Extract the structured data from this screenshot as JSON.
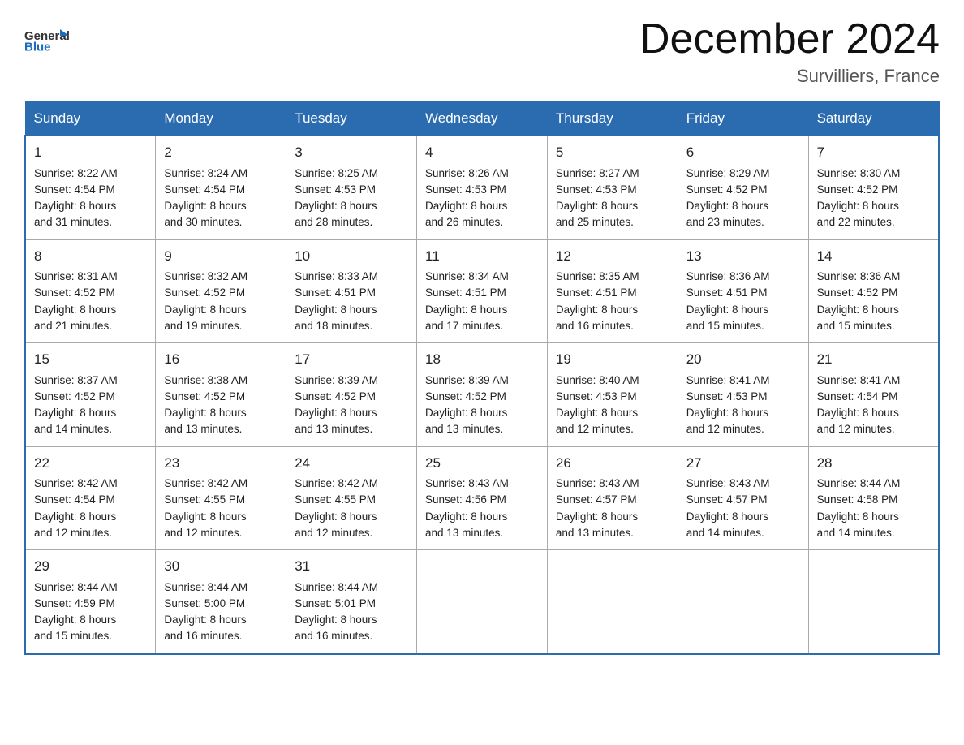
{
  "logo": {
    "general": "General",
    "blue": "Blue",
    "arrow_symbol": "▶"
  },
  "header": {
    "title": "December 2024",
    "subtitle": "Survilliers, France"
  },
  "days_of_week": [
    "Sunday",
    "Monday",
    "Tuesday",
    "Wednesday",
    "Thursday",
    "Friday",
    "Saturday"
  ],
  "weeks": [
    [
      {
        "day": "1",
        "sunrise": "8:22 AM",
        "sunset": "4:54 PM",
        "daylight": "8 hours and 31 minutes."
      },
      {
        "day": "2",
        "sunrise": "8:24 AM",
        "sunset": "4:54 PM",
        "daylight": "8 hours and 30 minutes."
      },
      {
        "day": "3",
        "sunrise": "8:25 AM",
        "sunset": "4:53 PM",
        "daylight": "8 hours and 28 minutes."
      },
      {
        "day": "4",
        "sunrise": "8:26 AM",
        "sunset": "4:53 PM",
        "daylight": "8 hours and 26 minutes."
      },
      {
        "day": "5",
        "sunrise": "8:27 AM",
        "sunset": "4:53 PM",
        "daylight": "8 hours and 25 minutes."
      },
      {
        "day": "6",
        "sunrise": "8:29 AM",
        "sunset": "4:52 PM",
        "daylight": "8 hours and 23 minutes."
      },
      {
        "day": "7",
        "sunrise": "8:30 AM",
        "sunset": "4:52 PM",
        "daylight": "8 hours and 22 minutes."
      }
    ],
    [
      {
        "day": "8",
        "sunrise": "8:31 AM",
        "sunset": "4:52 PM",
        "daylight": "8 hours and 21 minutes."
      },
      {
        "day": "9",
        "sunrise": "8:32 AM",
        "sunset": "4:52 PM",
        "daylight": "8 hours and 19 minutes."
      },
      {
        "day": "10",
        "sunrise": "8:33 AM",
        "sunset": "4:51 PM",
        "daylight": "8 hours and 18 minutes."
      },
      {
        "day": "11",
        "sunrise": "8:34 AM",
        "sunset": "4:51 PM",
        "daylight": "8 hours and 17 minutes."
      },
      {
        "day": "12",
        "sunrise": "8:35 AM",
        "sunset": "4:51 PM",
        "daylight": "8 hours and 16 minutes."
      },
      {
        "day": "13",
        "sunrise": "8:36 AM",
        "sunset": "4:51 PM",
        "daylight": "8 hours and 15 minutes."
      },
      {
        "day": "14",
        "sunrise": "8:36 AM",
        "sunset": "4:52 PM",
        "daylight": "8 hours and 15 minutes."
      }
    ],
    [
      {
        "day": "15",
        "sunrise": "8:37 AM",
        "sunset": "4:52 PM",
        "daylight": "8 hours and 14 minutes."
      },
      {
        "day": "16",
        "sunrise": "8:38 AM",
        "sunset": "4:52 PM",
        "daylight": "8 hours and 13 minutes."
      },
      {
        "day": "17",
        "sunrise": "8:39 AM",
        "sunset": "4:52 PM",
        "daylight": "8 hours and 13 minutes."
      },
      {
        "day": "18",
        "sunrise": "8:39 AM",
        "sunset": "4:52 PM",
        "daylight": "8 hours and 13 minutes."
      },
      {
        "day": "19",
        "sunrise": "8:40 AM",
        "sunset": "4:53 PM",
        "daylight": "8 hours and 12 minutes."
      },
      {
        "day": "20",
        "sunrise": "8:41 AM",
        "sunset": "4:53 PM",
        "daylight": "8 hours and 12 minutes."
      },
      {
        "day": "21",
        "sunrise": "8:41 AM",
        "sunset": "4:54 PM",
        "daylight": "8 hours and 12 minutes."
      }
    ],
    [
      {
        "day": "22",
        "sunrise": "8:42 AM",
        "sunset": "4:54 PM",
        "daylight": "8 hours and 12 minutes."
      },
      {
        "day": "23",
        "sunrise": "8:42 AM",
        "sunset": "4:55 PM",
        "daylight": "8 hours and 12 minutes."
      },
      {
        "day": "24",
        "sunrise": "8:42 AM",
        "sunset": "4:55 PM",
        "daylight": "8 hours and 12 minutes."
      },
      {
        "day": "25",
        "sunrise": "8:43 AM",
        "sunset": "4:56 PM",
        "daylight": "8 hours and 13 minutes."
      },
      {
        "day": "26",
        "sunrise": "8:43 AM",
        "sunset": "4:57 PM",
        "daylight": "8 hours and 13 minutes."
      },
      {
        "day": "27",
        "sunrise": "8:43 AM",
        "sunset": "4:57 PM",
        "daylight": "8 hours and 14 minutes."
      },
      {
        "day": "28",
        "sunrise": "8:44 AM",
        "sunset": "4:58 PM",
        "daylight": "8 hours and 14 minutes."
      }
    ],
    [
      {
        "day": "29",
        "sunrise": "8:44 AM",
        "sunset": "4:59 PM",
        "daylight": "8 hours and 15 minutes."
      },
      {
        "day": "30",
        "sunrise": "8:44 AM",
        "sunset": "5:00 PM",
        "daylight": "8 hours and 16 minutes."
      },
      {
        "day": "31",
        "sunrise": "8:44 AM",
        "sunset": "5:01 PM",
        "daylight": "8 hours and 16 minutes."
      },
      null,
      null,
      null,
      null
    ]
  ],
  "labels": {
    "sunrise": "Sunrise:",
    "sunset": "Sunset:",
    "daylight": "Daylight:"
  }
}
